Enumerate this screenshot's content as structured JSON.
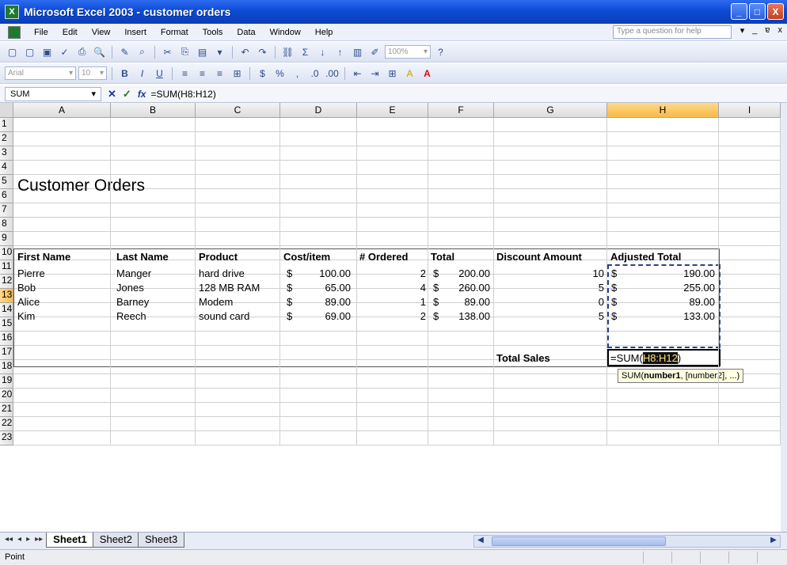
{
  "window": {
    "title": "Microsoft Excel 2003 - customer orders",
    "app_icon": "excel-icon",
    "controls": [
      "_",
      "□",
      "X"
    ]
  },
  "menu": {
    "items": [
      "File",
      "Edit",
      "View",
      "Insert",
      "Format",
      "Tools",
      "Data",
      "Window",
      "Help"
    ],
    "ask_placeholder": "Type a question for help",
    "controls": [
      "▾",
      "_",
      "ɐ",
      "x"
    ]
  },
  "toolbar1": {
    "icons": [
      "new-icon",
      "open-icon",
      "save-icon",
      "permission-icon",
      "print-icon",
      "print-preview-icon",
      "spelling-icon",
      "research-icon",
      "cut-icon",
      "copy-icon",
      "paste-icon",
      "format-painter-icon",
      "undo-icon",
      "redo-icon",
      "hyperlink-icon",
      "autosum-icon",
      "sort-ascending-icon",
      "sort-descending-icon",
      "chart-wizard-icon",
      "drawing-icon",
      "zoom-icon",
      "help-icon"
    ],
    "glyphs": [
      "▢",
      "▢",
      "▣",
      "✓",
      "⎙",
      "🔍",
      "✎",
      "⌕",
      "✂",
      "⎘",
      "▤",
      "▾",
      "↶",
      "↷",
      "⛓",
      "Σ",
      "↓",
      "↑",
      "▥",
      "✐",
      "",
      "?"
    ],
    "zoom": "100%"
  },
  "toolbar2": {
    "font": "Arial",
    "size": "10",
    "buttons": [
      "B",
      "I",
      "U",
      "≡",
      "≡",
      "≡",
      "⊞",
      "$",
      "%",
      ",",
      ".0",
      ".00",
      "⇤",
      "⇥",
      "⊞",
      "A",
      "A"
    ]
  },
  "formula_bar": {
    "name_box": "SUM",
    "cancel": "✕",
    "enter": "✓",
    "fx": "fx",
    "formula": "=SUM(H8:H12)"
  },
  "columns": [
    "A",
    "B",
    "C",
    "D",
    "E",
    "F",
    "G",
    "H",
    "I"
  ],
  "rows": [
    "1",
    "2",
    "3",
    "4",
    "5",
    "6",
    "7",
    "8",
    "9",
    "10",
    "11",
    "12",
    "13",
    "14",
    "15",
    "16",
    "17",
    "18",
    "19",
    "20",
    "21",
    "22",
    "23"
  ],
  "sheet": {
    "heading": "Customer Orders",
    "headers": [
      "First Name",
      "Last Name",
      "Product",
      "Cost/item",
      "# Ordered",
      "Total",
      "Discount Amount",
      "Adjusted Total"
    ],
    "rows": [
      {
        "first": "Pierre",
        "last": "Manger",
        "product": "hard drive",
        "cost_sym": "$",
        "cost": "100.00",
        "ordered": "2",
        "total_sym": "$",
        "total": "200.00",
        "discount": "10",
        "adj_sym": "$",
        "adj": "190.00"
      },
      {
        "first": "Bob",
        "last": "Jones",
        "product": "128 MB RAM",
        "cost_sym": "$",
        "cost": "65.00",
        "ordered": "4",
        "total_sym": "$",
        "total": "260.00",
        "discount": "5",
        "adj_sym": "$",
        "adj": "255.00"
      },
      {
        "first": "Alice",
        "last": "Barney",
        "product": "Modem",
        "cost_sym": "$",
        "cost": "89.00",
        "ordered": "1",
        "total_sym": "$",
        "total": "89.00",
        "discount": "0",
        "adj_sym": "$",
        "adj": "89.00"
      },
      {
        "first": "Kim",
        "last": "Reech",
        "product": "sound card",
        "cost_sym": "$",
        "cost": "69.00",
        "ordered": "2",
        "total_sym": "$",
        "total": "138.00",
        "discount": "5",
        "adj_sym": "$",
        "adj": "133.00"
      }
    ],
    "total_sales_label": "Total Sales",
    "active_prefix": "=SUM(",
    "active_ref": "H8:H12",
    "active_suffix": ")",
    "tooltip_fn": "SUM(",
    "tooltip_arg1": "number1",
    "tooltip_rest": ", [number2], ...)"
  },
  "tabs": {
    "nav": [
      "◂◂",
      "◂",
      "▸",
      "▸▸"
    ],
    "sheets": [
      "Sheet1",
      "Sheet2",
      "Sheet3"
    ],
    "active": "Sheet1"
  },
  "status": {
    "mode": "Point"
  },
  "colors": {
    "title_blue": "#0d4bd6",
    "selected_header": "#f8b94a",
    "marquee": "#2a3f8c",
    "tooltip_bg": "#ffffe1"
  }
}
